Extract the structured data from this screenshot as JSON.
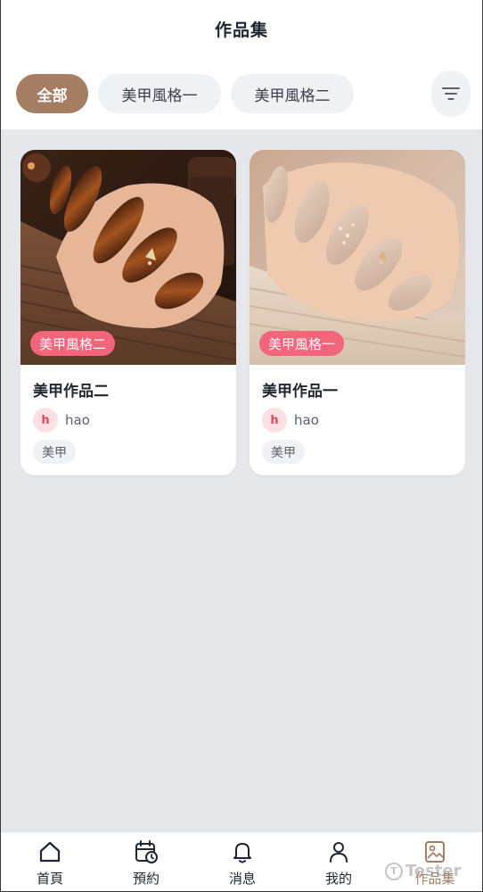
{
  "header": {
    "title": "作品集"
  },
  "filters": {
    "chips": [
      {
        "label": "全部",
        "active": true
      },
      {
        "label": "美甲風格一",
        "active": false
      },
      {
        "label": "美甲風格二",
        "active": false
      }
    ],
    "filter_icon": "filter-lines-icon"
  },
  "works": [
    {
      "style_badge": "美甲風格二",
      "title": "美甲作品二",
      "author_initial": "h",
      "author": "hao",
      "tag": "美甲",
      "image": "dark-brown-cat-eye-nails-photo"
    },
    {
      "style_badge": "美甲風格一",
      "title": "美甲作品一",
      "author_initial": "h",
      "author": "hao",
      "tag": "美甲",
      "image": "nude-beige-pearl-nails-photo"
    }
  ],
  "tabbar": {
    "items": [
      {
        "label": "首頁",
        "icon": "home-icon",
        "active": false
      },
      {
        "label": "預約",
        "icon": "calendar-clock-icon",
        "active": false
      },
      {
        "label": "消息",
        "icon": "bell-icon",
        "active": false
      },
      {
        "label": "我的",
        "icon": "user-icon",
        "active": false
      },
      {
        "label": "作品集",
        "icon": "image-icon",
        "active": true
      }
    ]
  },
  "watermark": {
    "text": "Tester",
    "glyph": "T"
  },
  "colors": {
    "accent": "#a47d62",
    "badge": "#f2657b",
    "background": "#e5e7ea"
  }
}
